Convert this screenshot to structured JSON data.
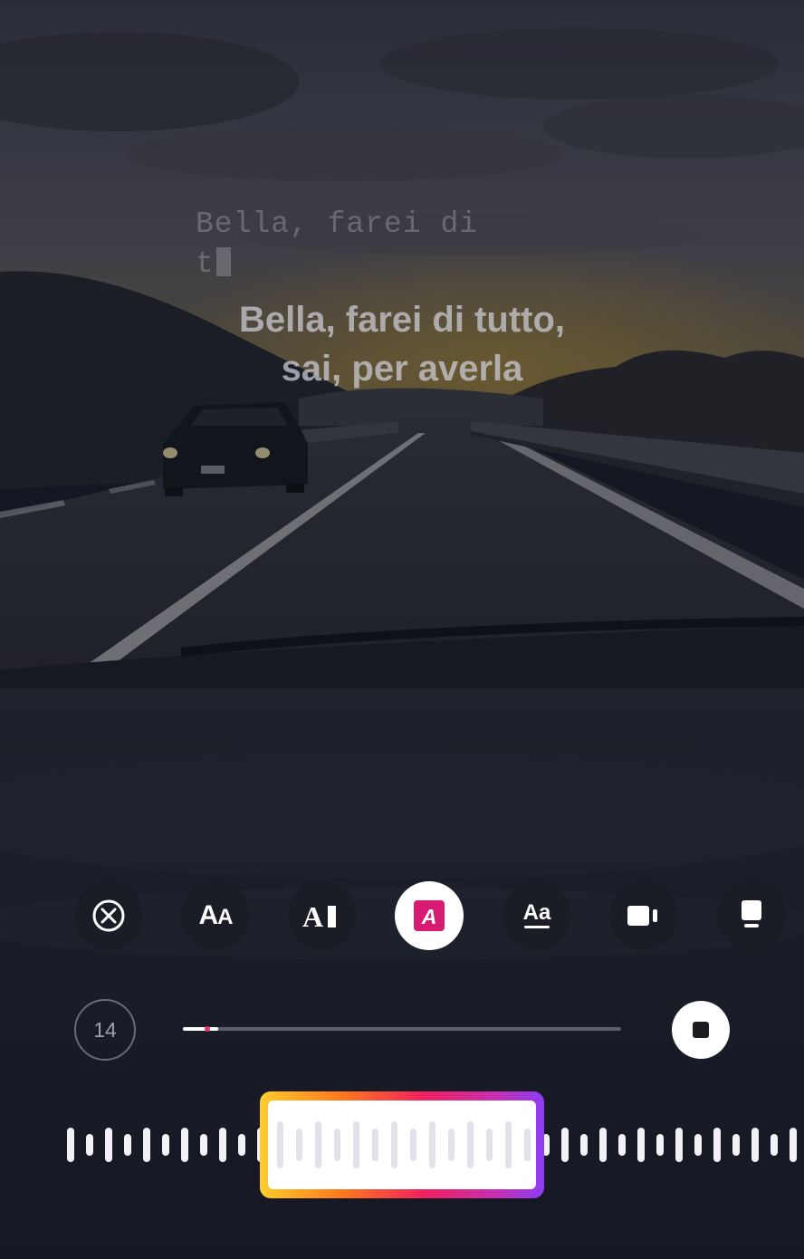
{
  "lyrics": {
    "typewriter_line1": "Bella, farei di",
    "typewriter_line2": "t",
    "main_line1": "Bella, farei di tutto,",
    "main_line2": "sai, per averla"
  },
  "toolbar": {
    "tools": [
      {
        "name": "remove-lyrics",
        "icon": "circle-x-icon",
        "active": false
      },
      {
        "name": "text-size-style",
        "icon": "aa-icon",
        "label": "AA",
        "active": false
      },
      {
        "name": "typewriter-style",
        "icon": "a-cursor-icon",
        "label": "A",
        "active": false
      },
      {
        "name": "highlight-style",
        "icon": "highlighted-a-icon",
        "label": "A",
        "active": true
      },
      {
        "name": "underline-style",
        "icon": "aa-underline-icon",
        "label": "Aa",
        "active": false
      },
      {
        "name": "video-card-style",
        "icon": "card-icon",
        "active": false
      },
      {
        "name": "album-card-style",
        "icon": "album-card-icon",
        "active": false
      }
    ],
    "accent_color": "#d81b72"
  },
  "timeline": {
    "clip_duration": "14",
    "progress_fraction": 0.08
  },
  "colors": {
    "selector_gradient": [
      "#ffcc2d",
      "#ff7a1a",
      "#f0205f",
      "#c82fae",
      "#8c3df5"
    ]
  }
}
